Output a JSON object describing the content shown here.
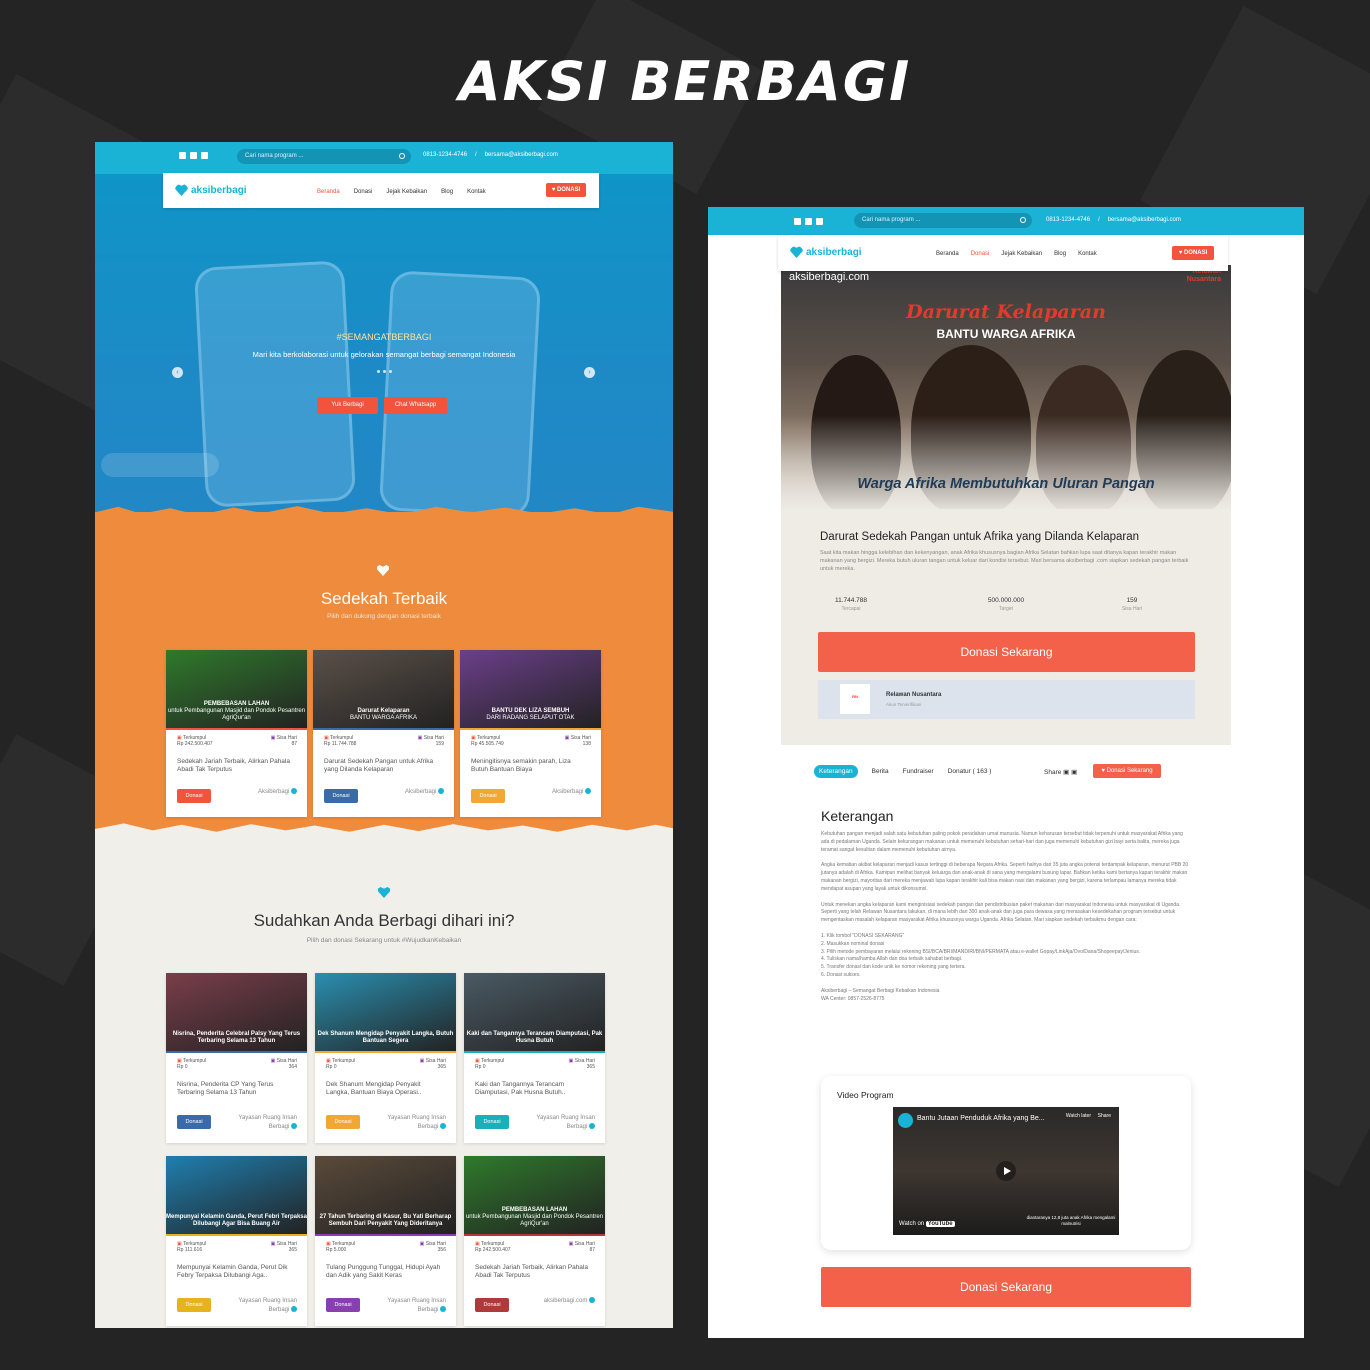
{
  "headline": "AKSI BERBAGI",
  "site": {
    "search_placeholder": "Cari nama program ...",
    "phone": "0813-1234-4746",
    "email": "bersama@aksiberbagi.com",
    "logo_text": "aksiberbagi",
    "logo_suffix": ".com",
    "nav": [
      "Beranda",
      "Donasi",
      "Jejak Kebaikan",
      "Blog",
      "Kontak"
    ],
    "donasi_label": "DONASI"
  },
  "hero": {
    "tag": "#SEMANGATBERBAGI",
    "subtitle": "Mari kita berkolaborasi untuk gelorakan semangat berbagi semangat Indonesia",
    "btn1": "Yuk Berbagi",
    "btn2": "Chat Whatsapp"
  },
  "section1": {
    "title": "Sedekah Terbaik",
    "subtitle": "Pilih dan dukung dengan donasi terbaik",
    "cards": [
      {
        "cap": "PEMBEBASAN LAHAN",
        "cap2": "untuk Pembangunan Masjid dan Pondok Pesantren AgriQur'an",
        "collected": "Rp 242.500.407",
        "days": "87",
        "title": "Sedekah Jariah Terbaik, Alirkan Pahala Abadi Tak Terputus",
        "btn": "Donasi",
        "org": "Aksiberbagi",
        "color": "#f2533d",
        "bg": "#2f7a2c"
      },
      {
        "cap": "Darurat Kelaparan",
        "cap2": "BANTU WARGA AFRIKA",
        "collected": "Rp 11.744.788",
        "days": "159",
        "title": "Darurat Sedekah Pangan untuk Afrika yang Dilanda Kelaparan",
        "btn": "Donasi",
        "org": "Aksiberbagi",
        "color": "#3a6aa8",
        "bg": "#5b5048"
      },
      {
        "cap": "BANTU DEK LIZA SEMBUH",
        "cap2": "DARI RADANG SELAPUT OTAK",
        "collected": "Rp 45.505.749",
        "days": "138",
        "title": "Meningitisnya semakin parah, Liza Butuh Bantuan Biaya",
        "btn": "Donasi",
        "org": "Aksiberbagi",
        "color": "#f0a733",
        "bg": "#6b3f8a"
      }
    ]
  },
  "section2": {
    "title": "Sudahkan Anda Berbagi dihari ini?",
    "subtitle": "Pilih dan donasi Sekarang untuk #WujudkanKebaikan",
    "cards": [
      {
        "cap": "Nisrina, Penderita Celebral Palsy Yang Terus Terbaring Selama 13 Tahun",
        "collected": "Rp 0",
        "days": "364",
        "title": "Nisrina, Penderita CP Yang Terus Terbaring Selama 13 Tahun",
        "btn": "Donasi",
        "org": "Yayasan Ruang Insan Berbagi",
        "color": "#3a6aa8",
        "bg": "#7a3e4a"
      },
      {
        "cap": "Dek Shanum Mengidap Penyakit Langka, Butuh Bantuan Segera",
        "collected": "Rp 0",
        "days": "365",
        "title": "Dek Shanum Mengidap Penyakit Langka, Bantuan Biaya Operasi..",
        "btn": "Donasi",
        "org": "Yayasan Ruang Insan Berbagi",
        "color": "#f0a733",
        "bg": "#2a8fb0"
      },
      {
        "cap": "Kaki dan Tangannya Terancam Diamputasi, Pak Husna Butuh",
        "collected": "Rp 0",
        "days": "365",
        "title": "Kaki dan Tangannya Terancam Diamputasi, Pak Husna Butuh..",
        "btn": "Donasi",
        "org": "Yayasan Ruang Insan Berbagi",
        "color": "#19b0b9",
        "bg": "#4a5a64"
      },
      {
        "cap": "Mempunyai Kelamin Ganda, Perut Febri Terpaksa Dilubangi Agar Bisa Buang Air",
        "collected": "Rp 111.616",
        "days": "365",
        "title": "Mempunyai Kelamin Ganda, Perut Dik Febry Terpaksa Dilubangi Aga..",
        "btn": "Donasi",
        "org": "Yayasan Ruang Insan Berbagi",
        "color": "#e6b31e",
        "bg": "#1f7fb0"
      },
      {
        "cap": "27 Tahun Terbaring di Kasur, Bu Yati Berharap Sembuh Dari Penyakit Yang Dideritanya",
        "collected": "Rp 5.000",
        "days": "356",
        "title": "Tulang Punggung Tunggal, Hidupi Ayah dan Adik yang Sakit Keras",
        "btn": "Donasi",
        "org": "Yayasan Ruang Insan Berbagi",
        "color": "#8a3fb0",
        "bg": "#5a4a3a"
      },
      {
        "cap": "PEMBEBASAN LAHAN",
        "cap2": "untuk Pembangunan Masjid dan Pondok Pesantren AgriQur'an",
        "collected": "Rp 242.500.407",
        "days": "87",
        "title": "Sedekah Jariah Terbaik, Alirkan Pahala Abadi Tak Terputus",
        "btn": "Donasi",
        "org": "aksiberbagi.com",
        "color": "#b03a3a",
        "bg": "#2f7a2c"
      }
    ]
  },
  "labels": {
    "collected": "Terkumpul",
    "days": "Sisa Hari"
  },
  "detail": {
    "banner_logo": "aksiberbagi.com",
    "banner_rn1": "Relawan",
    "banner_rn2": "Nusantara",
    "banner_t1": "Darurat Kelaparan",
    "banner_t2": "BANTU WARGA AFRIKA",
    "banner_t3": "Warga Afrika Membutuhkan Uluran Pangan",
    "title": "Darurat Sedekah Pangan untuk Afrika yang Dilanda Kelaparan",
    "desc": "Saat kita makan hingga kelebihan dan kekenyangan, anak Afrika khususnya bagian Afrika Selatan bahkan lupa saat ditanya kapan terakhir makan makanan yang bergizi. Mereka butuh uluran tangan untuk keluar dari kondisi tersebut. Mari bersama aksiberbagi .com siapkan sedekah pangan terbaik untuk mereka.",
    "stats": [
      {
        "value": "11.744.788",
        "label": "Tercapai"
      },
      {
        "value": "500.000.000",
        "label": "Target"
      },
      {
        "value": "159",
        "label": "Sisa Hari"
      }
    ],
    "donate_now": "Donasi Sekarang",
    "org_name": "Relawan Nusantara",
    "org_sub": "Akun Terverifikasi",
    "tabs": [
      "Keterangan",
      "Berita",
      "Fundraiser",
      "Donatur ( 163 )"
    ],
    "share": "Share",
    "share_btn": "Donasi Sekarang",
    "ket_title": "Keterangan",
    "ket_p1": "Kebutuhan pangan menjadi salah satu kebutuhan paling pokok peradaban umat manusia. Namun keharusan tersebut tidak terpenuhi untuk masyarakat Afrika yang ada di pedalaman Uganda. Selain kekurangan makanan untuk memenuhi kebutuhan sehari-hari dan juga memenuhi kebutuhan gizi bayi serta balita, mereka juga teramat sangat kesulitan dalam memenuhi kebutuhan airnya.",
    "ket_p2": "Angka kematian akibat kelaparan menjadi kasus tertinggi di beberapa Negara Afrika. Seperti halnya dari 35 juta angka potensi terdampak kelaparan, menurut PBB 20 jutanya adalah di Afrika. Kamipun melihat banyak keluarga dan anak-anak di sana yang mengalami busung lapar. Bahkan ketika kami bertanya kapan terakhir makan makanan bergizi, mayoritas dari mereka menjawab lupa kapan terakhir kali bisa makan nasi dan makanan yang bergizi, karena terlampau lamanya mereka tidak mendapat asupan yang layak untuk dikonsumsi.",
    "ket_p3": "Untuk menekan angka kelaparan kami menginisiasi sedekah pangan dan pendistribusian paket makanan dari masyarakat Indonesia untuk masyarakat di Uganda. Seperti yang telah Relawan Nusantara lakukan, di mana lebih dari 300 anak-anak dan juga para dewasa yang merasakan kesedekahan program tersebut untuk mengentaskan masalah kelaparan masyarakat Afrika khususnya warga Uganda. Afrika Selatan. Mari siapkan sedekah terbaikmu dengan cara:",
    "steps": [
      "1. Klik tombol \"DONASI SEKARANG\"",
      "2. Masukkan nominal donasi",
      "3. Pilih metode pembayaran melalui rekening BSI/BCA/BRI/MANDIRI/BNI/PERMATA atau e-wallet Gopay/LinkAja/Ovo/Dana/Shopeepay/Jenius.",
      "4. Tuliskan nama/hamba Allah dan doa terbaik sahabat berbagi.",
      "5. Transfer donasi dan kode unik ke nomor rekening yang tertera.",
      "6. Donasi sukses."
    ],
    "footer1": "Aksiberbagi – Semangat Berbagi Kebaikan Indonesia",
    "footer2": "WA Center: 0857-2526-8775",
    "video_title": "Video Program",
    "video_name": "Bantu Jutaan Penduduk Afrika yang Be...",
    "watch_later": "Watch later",
    "share_v": "Share",
    "watch_on": "Watch on",
    "youtube": "YouTube",
    "video_caption": "diantaranya 12,8 juta anak Afrika mengalami malnutrisi"
  }
}
